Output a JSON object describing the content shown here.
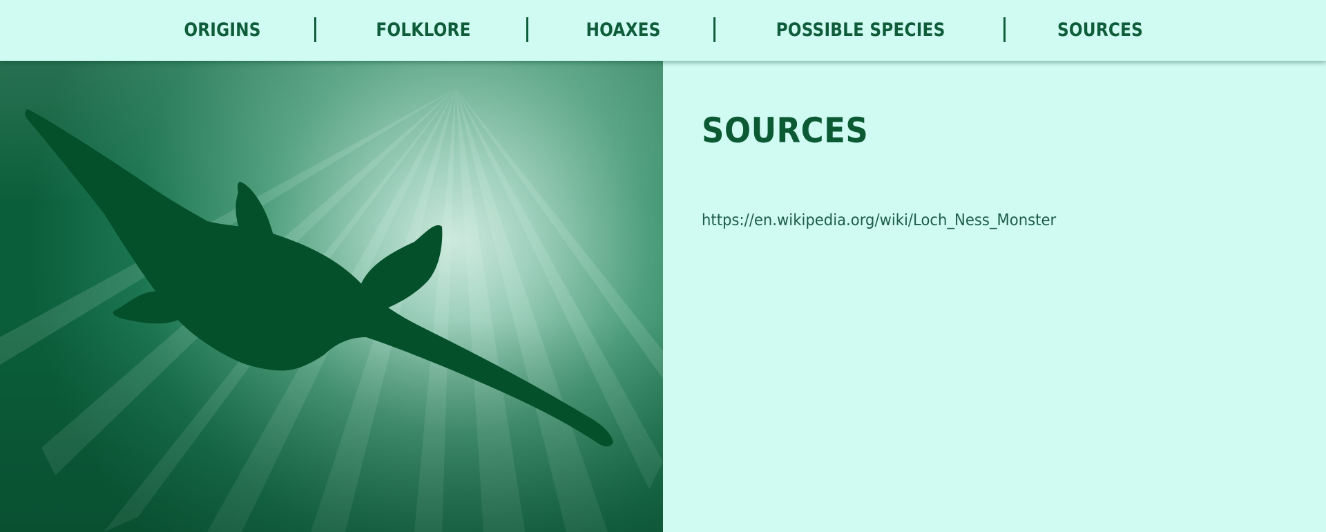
{
  "nav": {
    "items": [
      {
        "label": "ORIGINS"
      },
      {
        "label": "FOLKLORE"
      },
      {
        "label": "HOAXES"
      },
      {
        "label": "POSSIBLE SPECIES"
      },
      {
        "label": "SOURCES"
      }
    ]
  },
  "hero": {
    "image_subject": "plesiosaur-silhouette-underwater"
  },
  "main": {
    "title": "SOURCES",
    "links": [
      {
        "text": "https://en.wikipedia.org/wiki/Loch_Ness_Monster"
      }
    ]
  },
  "colors": {
    "background": "#d0fbf2",
    "text_dark_green": "#0e5c3a",
    "water_green": "#0f6a45",
    "creature": "#04502a"
  }
}
